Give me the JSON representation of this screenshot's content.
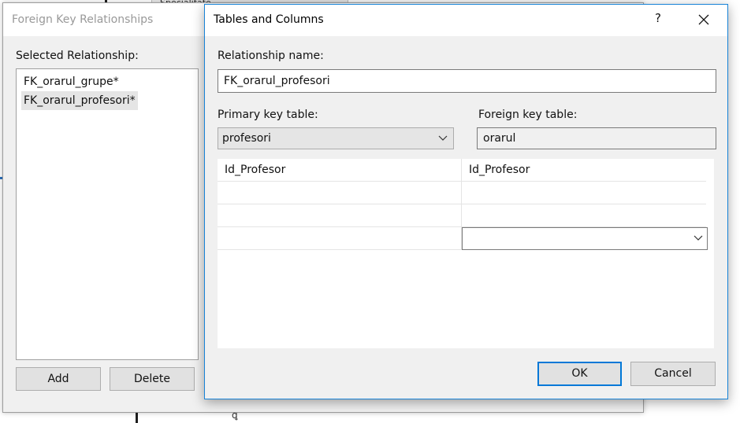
{
  "background": {
    "table_header_text": "Specialitate",
    "connector_glyph": "ꝗ"
  },
  "fk_dialog": {
    "title": "Foreign Key Relationships",
    "selected_label": "Selected Relationship:",
    "relationships": [
      {
        "name": "FK_orarul_grupe*",
        "selected": false
      },
      {
        "name": "FK_orarul_profesori*",
        "selected": true
      }
    ],
    "add_label": "Add",
    "delete_label": "Delete"
  },
  "tc_dialog": {
    "title": "Tables and Columns",
    "help_glyph": "?",
    "close_glyph": "✕",
    "relationship_name_label": "Relationship name:",
    "relationship_name_value": "FK_orarul_profesori",
    "primary_key_label": "Primary key table:",
    "primary_key_value": "profesori",
    "foreign_key_label": "Foreign key table:",
    "foreign_key_value": "orarul",
    "columns": [
      {
        "primary": "Id_Profesor",
        "foreign": "Id_Profesor"
      },
      {
        "primary": "",
        "foreign": ""
      },
      {
        "primary": "",
        "foreign": ""
      },
      {
        "primary": "",
        "foreign": ""
      }
    ],
    "ok_label": "OK",
    "cancel_label": "Cancel"
  },
  "colors": {
    "accent": "#0078d7",
    "dialog_bg": "#f0f0f0"
  }
}
